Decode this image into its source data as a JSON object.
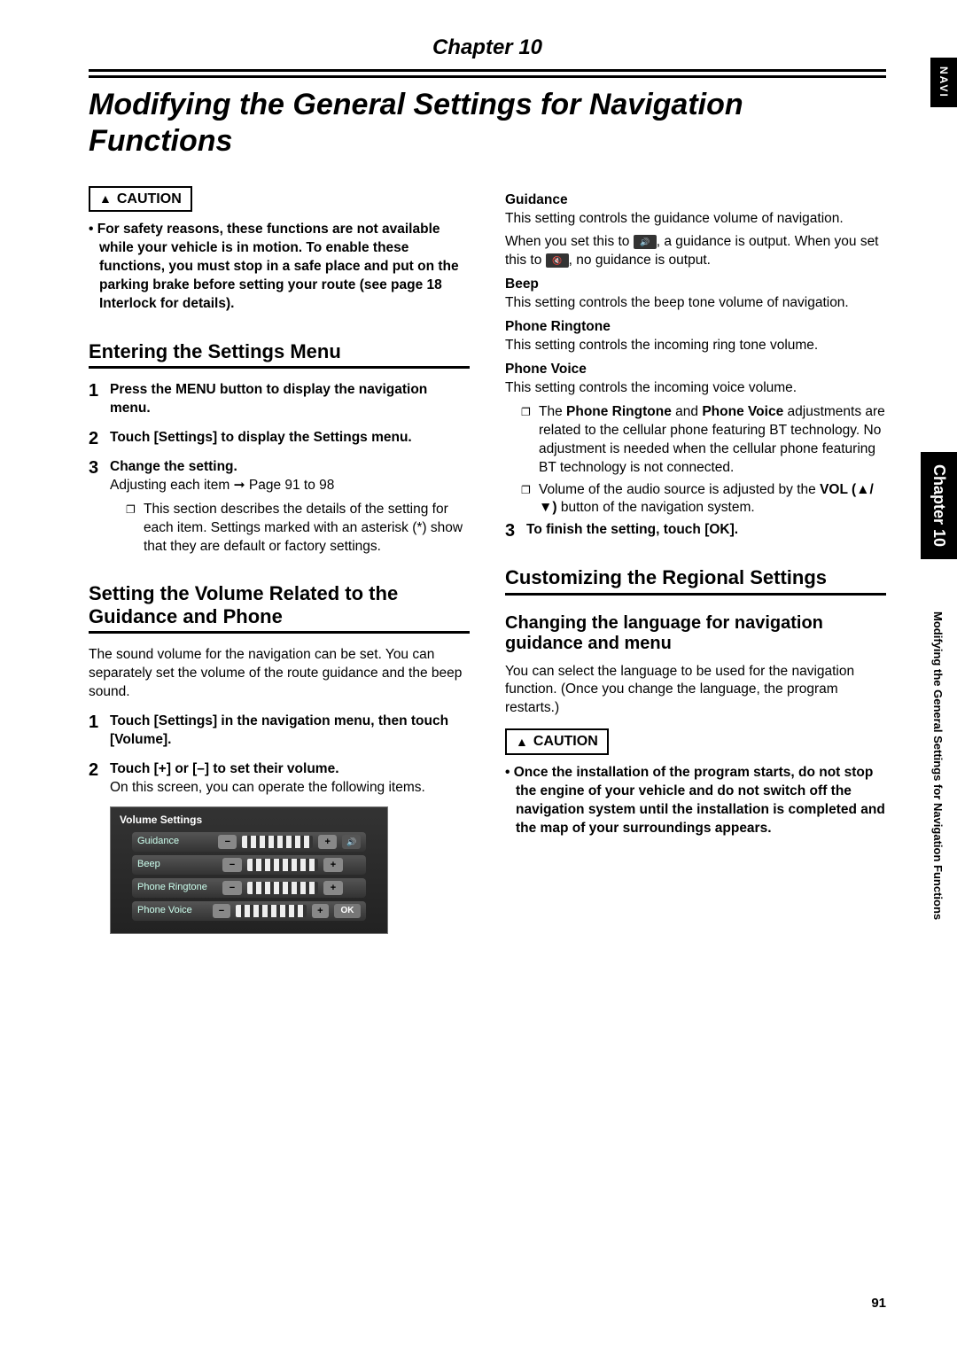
{
  "header": {
    "chapter_label": "Chapter 10",
    "page_title": "Modifying the General Settings for Navigation Functions",
    "navi_tab": "NAVI",
    "side_tab": "Chapter 10",
    "side_text": "Modifying the General Settings for Navigation Functions"
  },
  "caution_label": "CAUTION",
  "left": {
    "caution_bullet": "For safety reasons, these functions are not available while your vehicle is in motion. To enable these functions, you must stop in a safe place and put on the parking brake before setting your route (see page 18 Interlock for details).",
    "h2_entering": "Entering the Settings Menu",
    "steps_entering": [
      {
        "head": "Press the MENU button to display the navigation menu."
      },
      {
        "head": "Touch [Settings] to display the Settings menu."
      },
      {
        "head": "Change the setting.",
        "body": "Adjusting each item ➞ Page 91 to 98",
        "note": "This section describes the details of the setting for each item. Settings marked with an asterisk (*) show that they are default or factory settings."
      }
    ],
    "h2_volume": "Setting the Volume Related to the Guidance and Phone",
    "volume_intro": "The sound volume for the navigation can be set. You can separately set the volume of the route guidance and the beep sound.",
    "steps_volume": [
      {
        "head": "Touch [Settings] in the navigation menu, then touch [Volume]."
      },
      {
        "head": "Touch [+] or [–] to set their volume.",
        "body": "On this screen, you can operate the following items."
      }
    ],
    "vol_screen": {
      "title": "Volume Settings",
      "rows": [
        "Guidance",
        "Beep",
        "Phone Ringtone",
        "Phone Voice"
      ],
      "ok": "OK"
    }
  },
  "right": {
    "defs": [
      {
        "head": "Guidance",
        "body": "This setting controls the guidance volume of navigation."
      },
      {
        "extra1": "When you set this to ",
        "extra_icon1": "🔊",
        "extra_mid": ", a guidance is output. When you set this to ",
        "extra_icon2": "🔇",
        "extra2": ", no guidance is output."
      },
      {
        "head": "Beep",
        "body": "This setting controls the beep tone volume of navigation."
      },
      {
        "head": "Phone Ringtone",
        "body": "This setting controls the incoming ring tone volume."
      },
      {
        "head": "Phone Voice",
        "body": "This setting controls the incoming voice volume."
      }
    ],
    "notes": [
      "The Phone Ringtone and Phone Voice adjustments are related to the cellular phone featuring BT technology. No adjustment is needed when the cellular phone featuring BT technology is not connected.",
      "Volume of the audio source is adjusted by the VOL (▲/▼) button of the navigation system."
    ],
    "note_bold_a": "Phone Ringtone",
    "note_bold_b": "Phone Voice",
    "note_bold_c": "VOL (▲/▼)",
    "step3": "To finish the setting, touch [OK].",
    "h2_regional": "Customizing the Regional Settings",
    "h3_language": "Changing the language for navigation guidance and menu",
    "lang_body": "You can select the language to be used for the navigation function. (Once you change the language, the program restarts.)",
    "caution_bullet": "Once the installation of the program starts, do not stop the engine of your vehicle and do not switch off the navigation system until the installation is completed and the map of your surroundings appears."
  },
  "page_number": "91"
}
